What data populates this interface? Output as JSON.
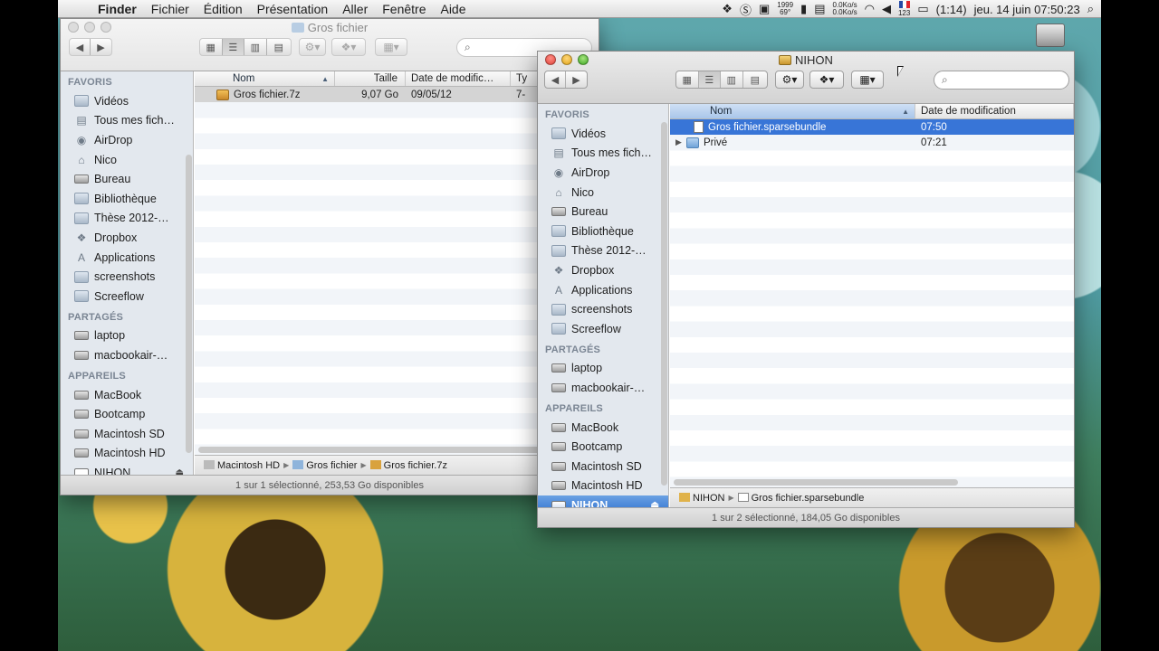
{
  "menubar": {
    "apple": "",
    "app": "Finder",
    "items": [
      "Fichier",
      "Édition",
      "Présentation",
      "Aller",
      "Fenêtre",
      "Aide"
    ],
    "temp_top": "1999",
    "temp_bottom": "69°",
    "net_up": "0.0Ko/s",
    "net_down": "0.0Ko/s",
    "flag_label": "123",
    "battery": "(1:14)",
    "clock": "jeu. 14 juin 07:50:23"
  },
  "win1": {
    "title": "Gros fichier",
    "search_placeholder": "",
    "sidebar": {
      "favoris_header": "FAVORIS",
      "favoris": [
        "Vidéos",
        "Tous mes fich…",
        "AirDrop",
        "Nico",
        "Bureau",
        "Bibliothèque",
        "Thèse 2012-…",
        "Dropbox",
        "Applications",
        "screenshots",
        "Screeflow"
      ],
      "partages_header": "PARTAGÉS",
      "partages": [
        "laptop",
        "macbookair-…"
      ],
      "appareils_header": "APPAREILS",
      "appareils": [
        "MacBook",
        "Bootcamp",
        "Macintosh SD",
        "Macintosh HD",
        "NIHON"
      ]
    },
    "columns": {
      "name": "Nom",
      "size": "Taille",
      "date": "Date de modific…",
      "type": "Ty"
    },
    "rows": [
      {
        "name": "Gros fichier.7z",
        "size": "9,07 Go",
        "date": "09/05/12",
        "type": "7-"
      }
    ],
    "path": [
      "Macintosh HD",
      "Gros fichier",
      "Gros fichier.7z"
    ],
    "status": "1 sur 1 sélectionné, 253,53 Go disponibles"
  },
  "win2": {
    "title": "NIHON",
    "search_placeholder": "",
    "sidebar": {
      "favoris_header": "FAVORIS",
      "favoris": [
        "Vidéos",
        "Tous mes fich…",
        "AirDrop",
        "Nico",
        "Bureau",
        "Bibliothèque",
        "Thèse 2012-…",
        "Dropbox",
        "Applications",
        "screenshots",
        "Screeflow"
      ],
      "partages_header": "PARTAGÉS",
      "partages": [
        "laptop",
        "macbookair-…"
      ],
      "appareils_header": "APPAREILS",
      "appareils": [
        "MacBook",
        "Bootcamp",
        "Macintosh SD",
        "Macintosh HD",
        "NIHON"
      ]
    },
    "columns": {
      "name": "Nom",
      "date": "Date de modification"
    },
    "rows": [
      {
        "name": "Gros fichier.sparsebundle",
        "date": "07:50"
      },
      {
        "name": "Privé",
        "date": "07:21"
      }
    ],
    "path": [
      "NIHON",
      "Gros fichier.sparsebundle"
    ],
    "status": "1 sur 2 sélectionné, 184,05 Go disponibles"
  },
  "colors": {
    "selection": "#3875d7",
    "sidebar_bg": "#e3e8ee",
    "sidebar_selection": "#2e6fce"
  }
}
